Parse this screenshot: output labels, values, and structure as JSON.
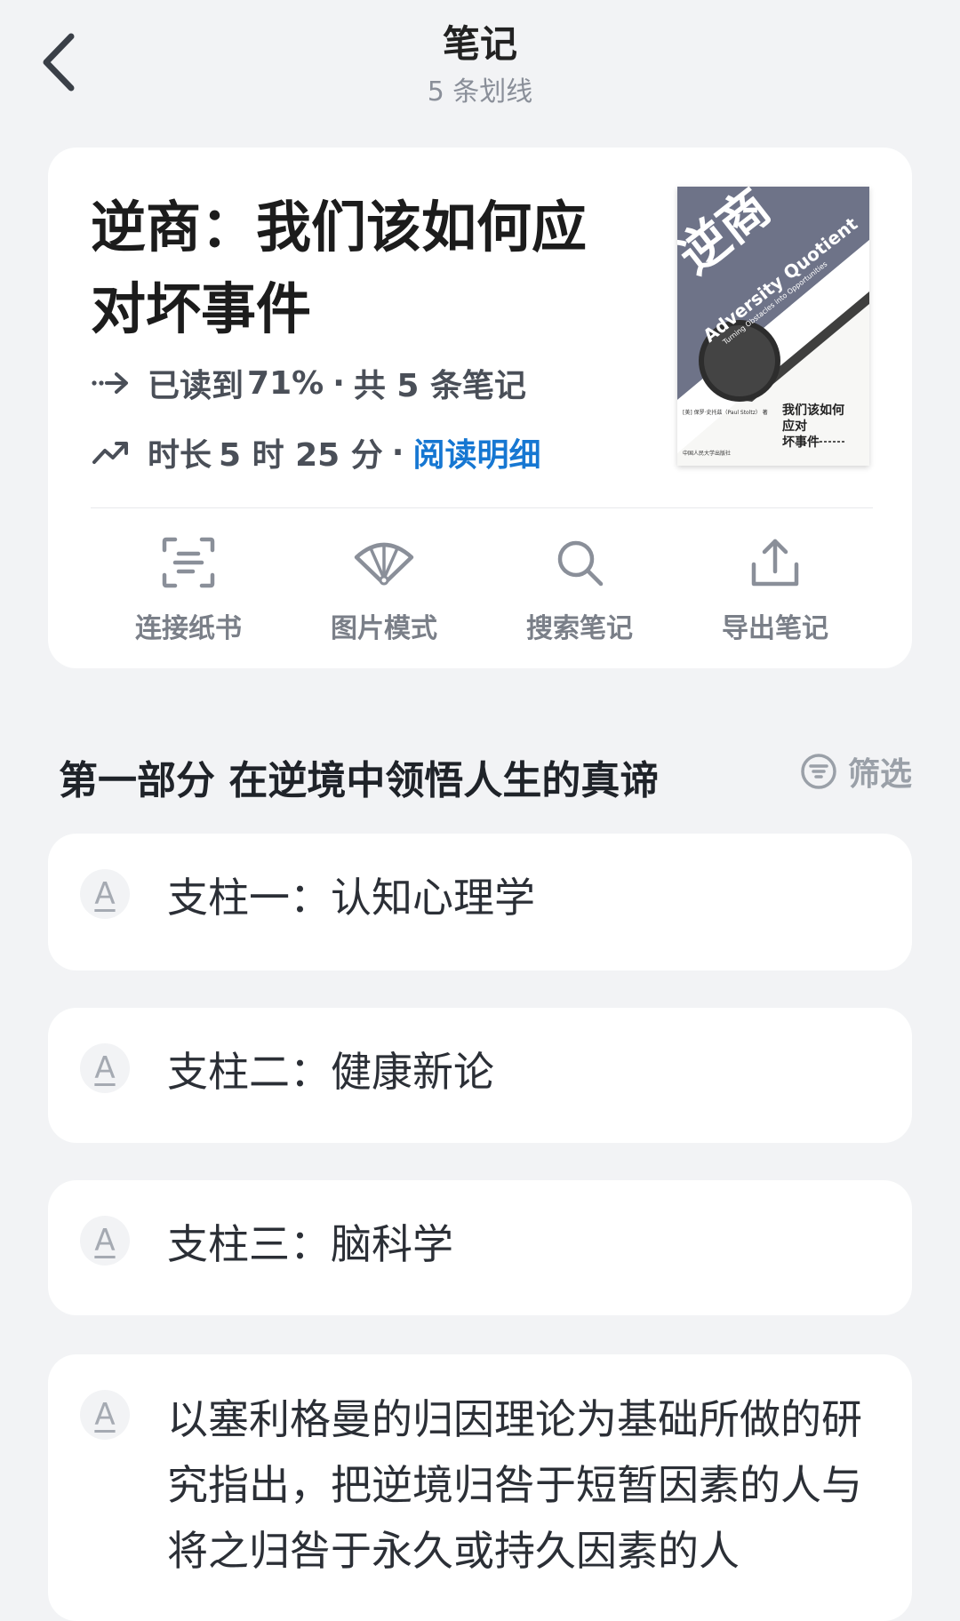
{
  "header": {
    "title": "笔记",
    "subtitle": "5 条划线"
  },
  "book": {
    "title": "逆商：我们该如何应对坏事件",
    "progress_prefix": "已读到",
    "progress_value": "71%",
    "notes_summary": "共 5 条笔记",
    "duration_prefix": "时长",
    "duration_value": "5 时 25 分",
    "detail_link": "阅读明细",
    "cover": {
      "title_cn": "逆商",
      "title_en": "Adversity Quotient",
      "tagline": "Turning Obstacles into Opportunities",
      "subtitle_lines": [
        "我们该如何",
        "应对",
        "坏事件"
      ],
      "author": "[美] 保罗·史托兹（Paul Stoltz） 著",
      "publisher": "中国人民大学出版社"
    }
  },
  "actions": [
    {
      "label": "连接纸书",
      "icon": "scan-book-icon"
    },
    {
      "label": "图片模式",
      "icon": "fan-image-icon"
    },
    {
      "label": "搜索笔记",
      "icon": "search-icon"
    },
    {
      "label": "导出笔记",
      "icon": "export-icon"
    }
  ],
  "section": {
    "title": "第一部分 在逆境中领悟人生的真谛",
    "filter_label": "筛选"
  },
  "notes": [
    {
      "badge": "A",
      "text": "支柱一：认知心理学"
    },
    {
      "badge": "A",
      "text": "支柱二：健康新论"
    },
    {
      "badge": "A",
      "text": "支柱三：脑科学"
    },
    {
      "badge": "A",
      "text": "以塞利格曼的归因理论为基础所做的研究指出，把逆境归咎于短暂因素的人与将之归咎于永久或持久因素的人"
    }
  ],
  "colors": {
    "background": "#f2f3f5",
    "card": "#ffffff",
    "link": "#1677d2",
    "muted": "#8a8f99",
    "cover_slate": "#6e7388"
  }
}
